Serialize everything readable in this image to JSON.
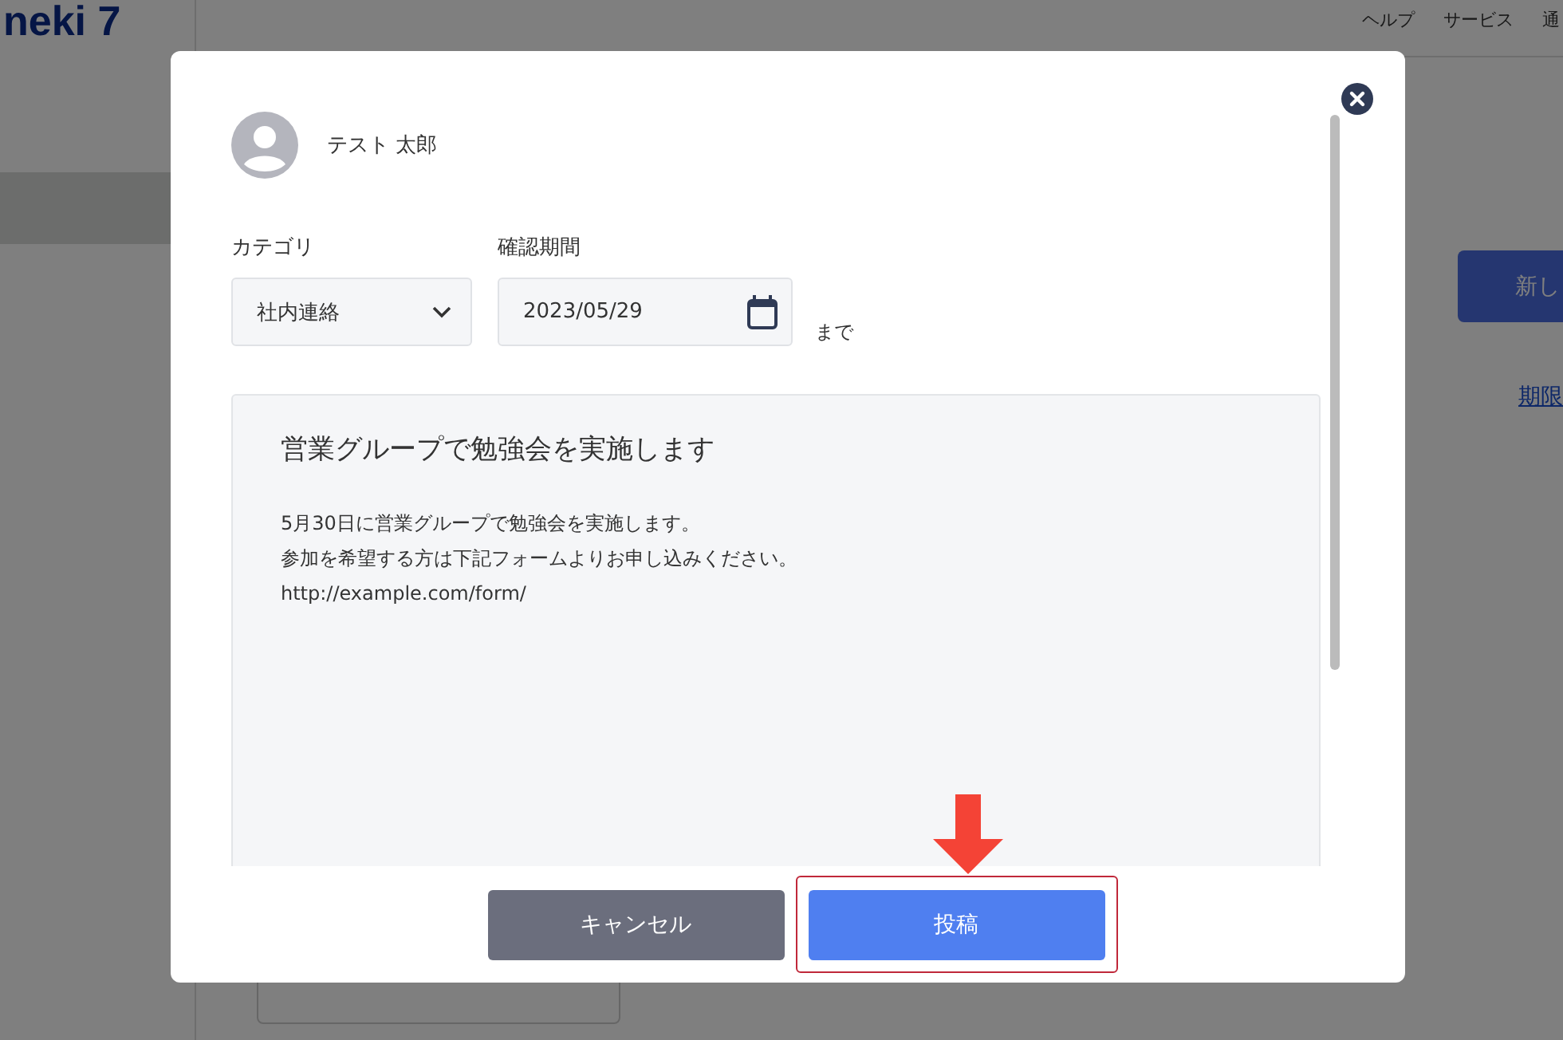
{
  "background": {
    "logo": "neki 7",
    "header_links": [
      "ヘルプ",
      "サービス",
      "通"
    ],
    "new_button": "新し",
    "link": "期限"
  },
  "dialog": {
    "user": {
      "name": "テスト 太郎"
    },
    "category": {
      "label": "カテゴリ",
      "value": "社内連絡"
    },
    "period": {
      "label": "確認期間",
      "value": "2023/05/29",
      "suffix": "まで"
    },
    "post": {
      "title": "営業グループで勉強会を実施します",
      "lines": [
        "5月30日に営業グループで勉強会を実施します。",
        "参加を希望する方は下記フォームよりお申し込みください。",
        "http://example.com/form/"
      ]
    },
    "buttons": [
      {
        "label": "キャンセル",
        "kind": "cancel",
        "highlighted": false
      },
      {
        "label": "投稿",
        "kind": "submit",
        "highlighted": true
      }
    ]
  }
}
